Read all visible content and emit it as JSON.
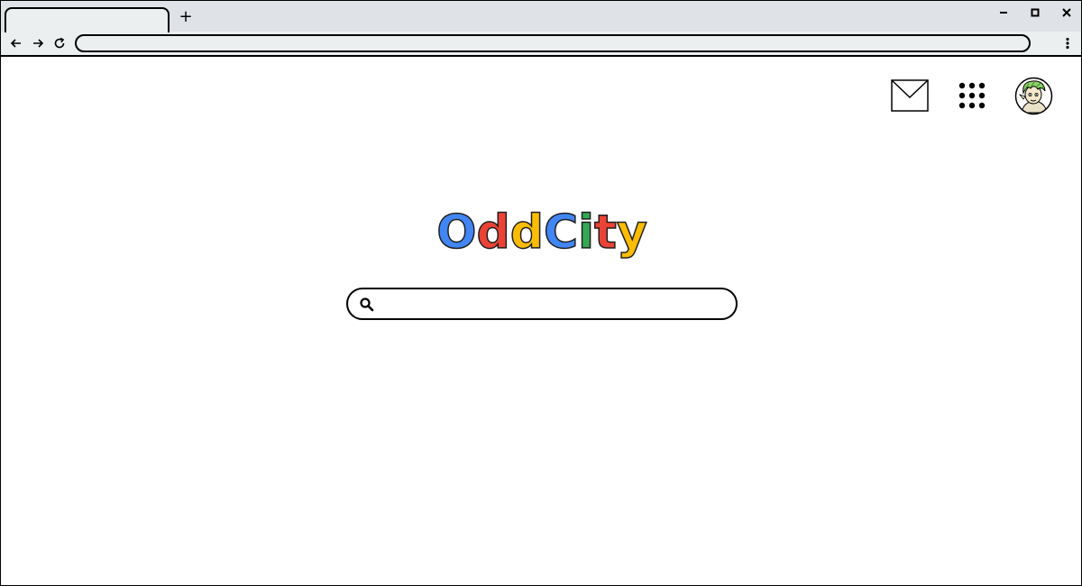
{
  "browser": {
    "tab_title": "",
    "new_tab_label": "+",
    "address_value": "",
    "icons": {
      "back": "arrow-left-icon",
      "forward": "arrow-right-icon",
      "reload": "reload-icon",
      "menu": "kebab-menu-icon",
      "minimize": "minimize-icon",
      "maximize": "maximize-icon",
      "close": "close-icon"
    }
  },
  "header": {
    "mail_icon": "mail-icon",
    "apps_icon": "apps-grid-icon",
    "avatar_icon": "avatar"
  },
  "logo": {
    "letters": [
      {
        "char": "O",
        "color": "#4285f4"
      },
      {
        "char": "d",
        "color": "#ea4335"
      },
      {
        "char": "d",
        "color": "#fbbc05"
      },
      {
        "char": "C",
        "color": "#4285f4"
      },
      {
        "char": "i",
        "color": "#34a853"
      },
      {
        "char": "t",
        "color": "#ea4335"
      },
      {
        "char": "y",
        "color": "#fbbc05"
      }
    ]
  },
  "search": {
    "value": "",
    "placeholder": "",
    "icon": "search-icon"
  }
}
